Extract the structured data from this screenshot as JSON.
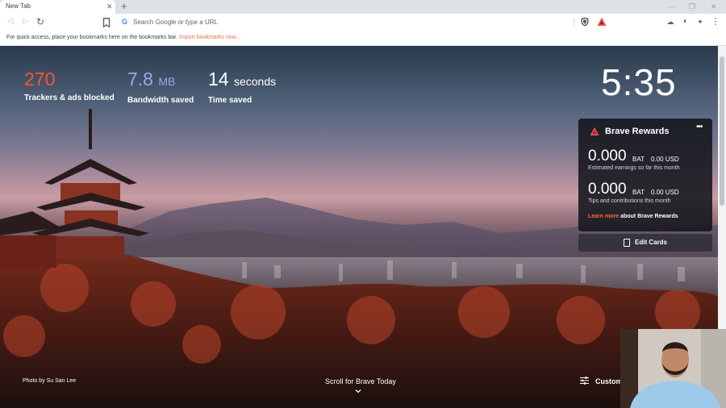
{
  "browser": {
    "tab": {
      "title": "New Tab",
      "close_glyph": "✕"
    },
    "new_tab_glyph": "+",
    "window_controls": {
      "minimize": "—",
      "restore": "❐",
      "close": "✕"
    },
    "toolbar": {
      "back_glyph": "◁",
      "forward_glyph": "▷",
      "reload_glyph": "↻",
      "bookmark_icon": "bookmark-icon",
      "omnibox_placeholder": "Search Google or type a URL",
      "google_glyph": "G",
      "menu_glyph": "⋮",
      "extensions_glyph": "✦",
      "profile_glyph": "◐",
      "cloud_glyph": "☁"
    },
    "bookmarks_bar": {
      "text": "For quick access, place your bookmarks here on the bookmarks bar.",
      "link": "Import bookmarks now..."
    }
  },
  "stats": [
    {
      "value": "270",
      "unit": "",
      "label": "Trackers & ads blocked",
      "color": "#fb542b"
    },
    {
      "value": "7.8",
      "unit": "MB",
      "label": "Bandwidth saved",
      "color": "#a0a5eb"
    },
    {
      "value": "14",
      "unit": "seconds",
      "label": "Time saved",
      "color": "#ffffff"
    }
  ],
  "clock": "5:35",
  "rewards": {
    "title": "Brave Rewards",
    "more_glyph": "•••",
    "earnings": {
      "amount": "0.000",
      "currency": "BAT",
      "usd": "0.00 USD",
      "description": "Estimated earnings so far this month"
    },
    "tips": {
      "amount": "0.000",
      "currency": "BAT",
      "usd": "0.00 USD",
      "description": "Tips and contributions this month"
    },
    "learn_more_link": "Learn more",
    "learn_more_text": " about Brave Rewards"
  },
  "edit_cards_label": "Edit Cards",
  "photo_credit": {
    "prefix": "Photo by ",
    "author": "Su San Lee"
  },
  "scroll_label": "Scroll for Brave Today",
  "customize_label": "Custom",
  "colors": {
    "accent": "#fb542b",
    "bandwidth": "#a0a5eb",
    "link": "#ff6b3d"
  }
}
